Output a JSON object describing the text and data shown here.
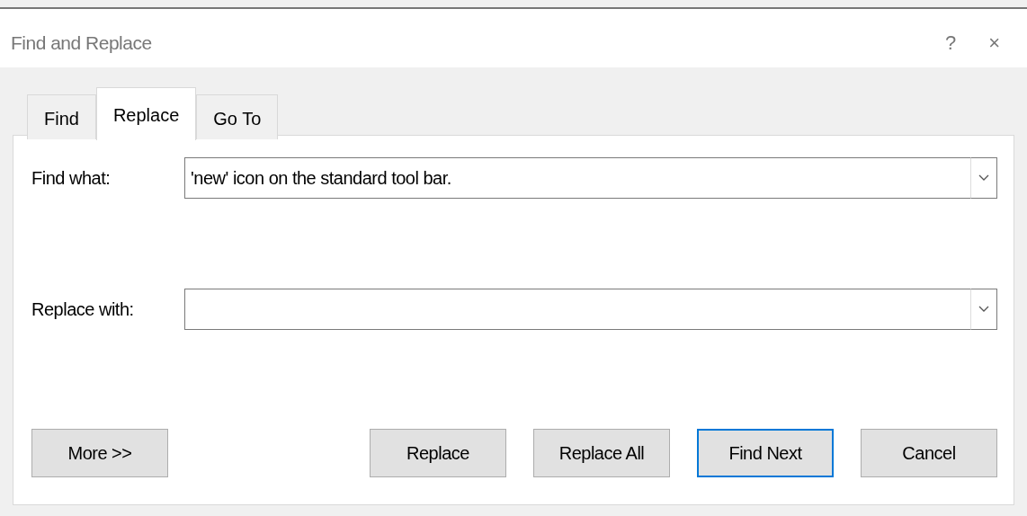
{
  "window": {
    "title": "Find and Replace",
    "help": "?",
    "close": "×"
  },
  "tabs": [
    {
      "label": "Find",
      "selected": false
    },
    {
      "label": "Replace",
      "selected": true
    },
    {
      "label": "Go To",
      "selected": false
    }
  ],
  "fields": [
    {
      "label": "Find what:",
      "value": "'new' icon on the standard tool bar."
    },
    {
      "label": "Replace with:"
    }
  ],
  "buttons": [
    {
      "label": "More >>",
      "default": false
    },
    {
      "label": "Replace",
      "default": false
    },
    {
      "label": "Replace All",
      "default": false
    },
    {
      "label": "Find Next",
      "default": true
    },
    {
      "label": "Cancel",
      "default": false
    }
  ]
}
